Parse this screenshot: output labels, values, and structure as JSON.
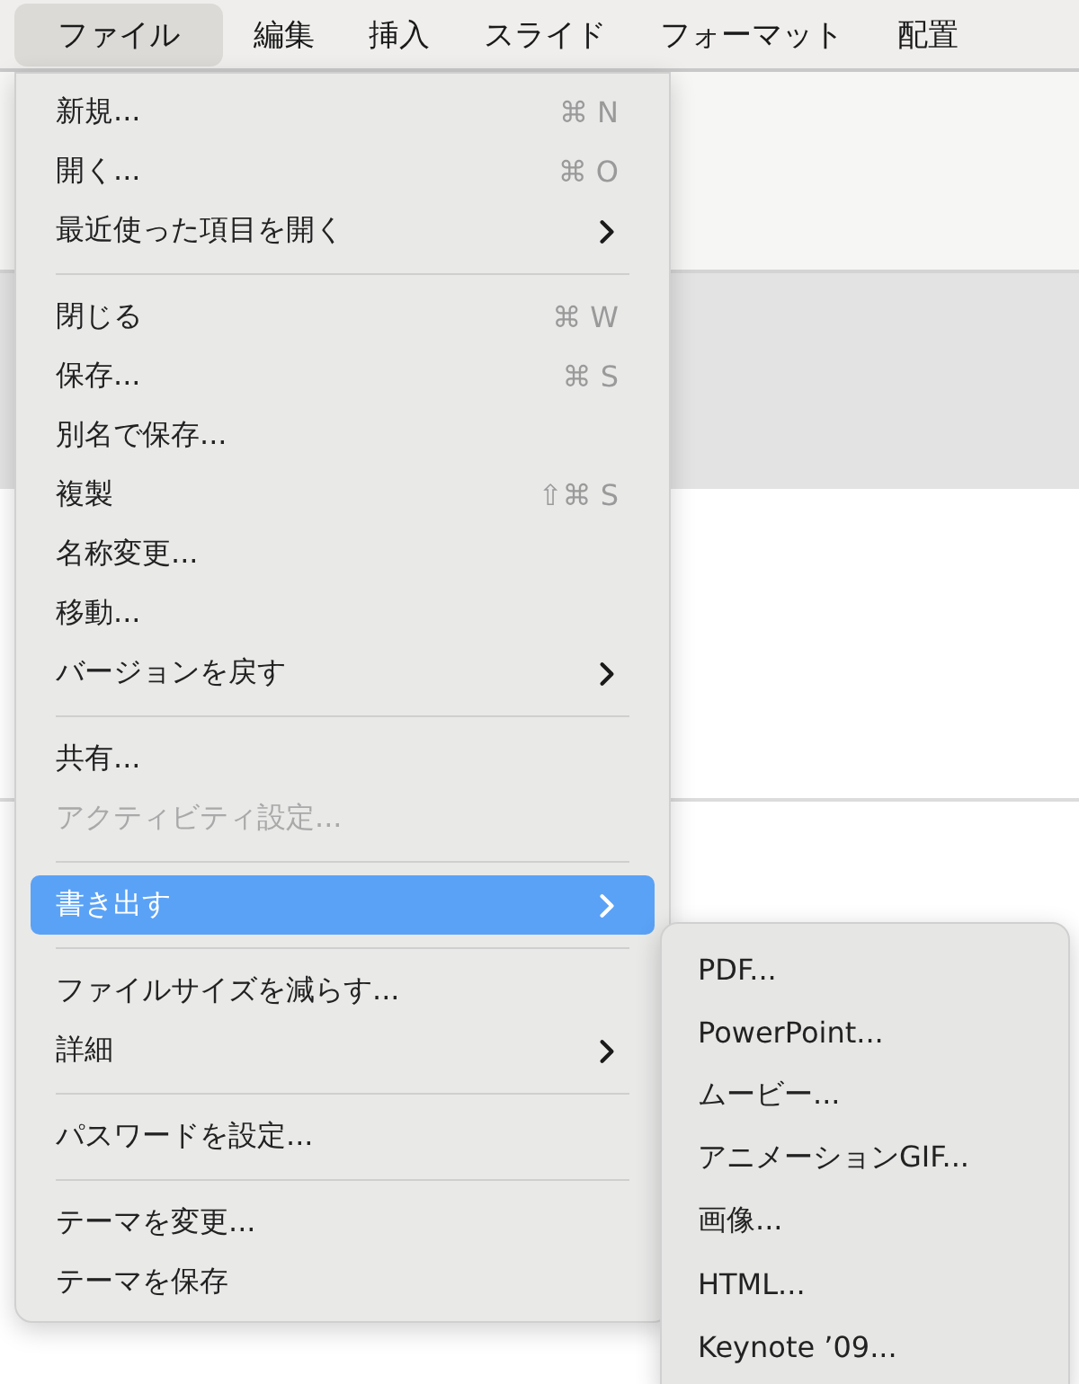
{
  "menubar": [
    {
      "label": "ファイル",
      "selected": true
    },
    {
      "label": "編集",
      "selected": false
    },
    {
      "label": "挿入",
      "selected": false
    },
    {
      "label": "スライド",
      "selected": false
    },
    {
      "label": "フォーマット",
      "selected": false
    },
    {
      "label": "配置",
      "selected": false
    }
  ],
  "file_menu": {
    "items": [
      {
        "kind": "item",
        "label": "新規...",
        "shortcut": "⌘ N",
        "submenu": false,
        "disabled": false,
        "selected": false
      },
      {
        "kind": "item",
        "label": "開く...",
        "shortcut": "⌘ O",
        "submenu": false,
        "disabled": false,
        "selected": false
      },
      {
        "kind": "item",
        "label": "最近使った項目を開く",
        "submenu": true,
        "disabled": false,
        "selected": false
      },
      {
        "kind": "separator"
      },
      {
        "kind": "item",
        "label": "閉じる",
        "shortcut": "⌘ W",
        "submenu": false,
        "disabled": false,
        "selected": false
      },
      {
        "kind": "item",
        "label": "保存...",
        "shortcut": "⌘ S",
        "submenu": false,
        "disabled": false,
        "selected": false
      },
      {
        "kind": "item",
        "label": "別名で保存...",
        "submenu": false,
        "disabled": false,
        "selected": false
      },
      {
        "kind": "item",
        "label": "複製",
        "shortcut": "⇧⌘ S",
        "submenu": false,
        "disabled": false,
        "selected": false
      },
      {
        "kind": "item",
        "label": "名称変更...",
        "submenu": false,
        "disabled": false,
        "selected": false
      },
      {
        "kind": "item",
        "label": "移動...",
        "submenu": false,
        "disabled": false,
        "selected": false
      },
      {
        "kind": "item",
        "label": "バージョンを戻す",
        "submenu": true,
        "disabled": false,
        "selected": false
      },
      {
        "kind": "separator"
      },
      {
        "kind": "item",
        "label": "共有...",
        "submenu": false,
        "disabled": false,
        "selected": false
      },
      {
        "kind": "item",
        "label": "アクティビティ設定...",
        "submenu": false,
        "disabled": true,
        "selected": false
      },
      {
        "kind": "separator"
      },
      {
        "kind": "item",
        "label": "書き出す",
        "submenu": true,
        "disabled": false,
        "selected": true
      },
      {
        "kind": "separator"
      },
      {
        "kind": "item",
        "label": "ファイルサイズを減らす...",
        "submenu": false,
        "disabled": false,
        "selected": false
      },
      {
        "kind": "item",
        "label": "詳細",
        "submenu": true,
        "disabled": false,
        "selected": false
      },
      {
        "kind": "separator"
      },
      {
        "kind": "item",
        "label": "パスワードを設定...",
        "submenu": false,
        "disabled": false,
        "selected": false
      },
      {
        "kind": "separator"
      },
      {
        "kind": "item",
        "label": "テーマを変更...",
        "submenu": false,
        "disabled": false,
        "selected": false
      },
      {
        "kind": "item",
        "label": "テーマを保存",
        "submenu": false,
        "disabled": false,
        "selected": false
      }
    ]
  },
  "export_submenu": {
    "items": [
      {
        "label": "PDF..."
      },
      {
        "label": "PowerPoint..."
      },
      {
        "label": "ムービー..."
      },
      {
        "label": "アニメーションGIF..."
      },
      {
        "label": "画像..."
      },
      {
        "label": "HTML..."
      },
      {
        "label": "Keynote ’09..."
      }
    ]
  }
}
